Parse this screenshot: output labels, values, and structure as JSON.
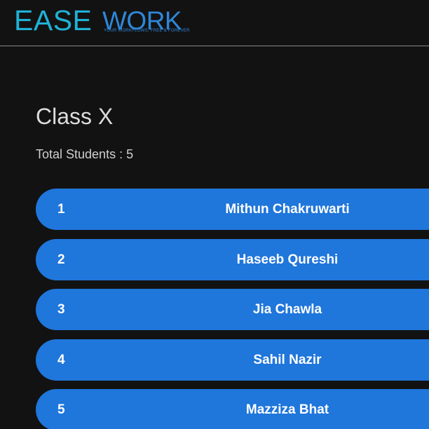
{
  "header": {
    "logo_ease": "EASE",
    "logo_work": "WORK",
    "logo_tagline": "YOUR WORKFLOWS, FREE & FOREVER"
  },
  "main": {
    "class_title": "Class X",
    "total_students_label": "Total Students : 5",
    "students": [
      {
        "number": "1",
        "name": "Mithun Chakruwarti"
      },
      {
        "number": "2",
        "name": "Haseeb Qureshi"
      },
      {
        "number": "3",
        "name": "Jia Chawla"
      },
      {
        "number": "4",
        "name": "Sahil Nazir"
      },
      {
        "number": "5",
        "name": "Mazziza Bhat"
      }
    ]
  },
  "colors": {
    "background": "#121212",
    "row_accent": "#1f76db",
    "logo_ease": "#1fb1d6",
    "logo_work": "#2f86d8"
  }
}
